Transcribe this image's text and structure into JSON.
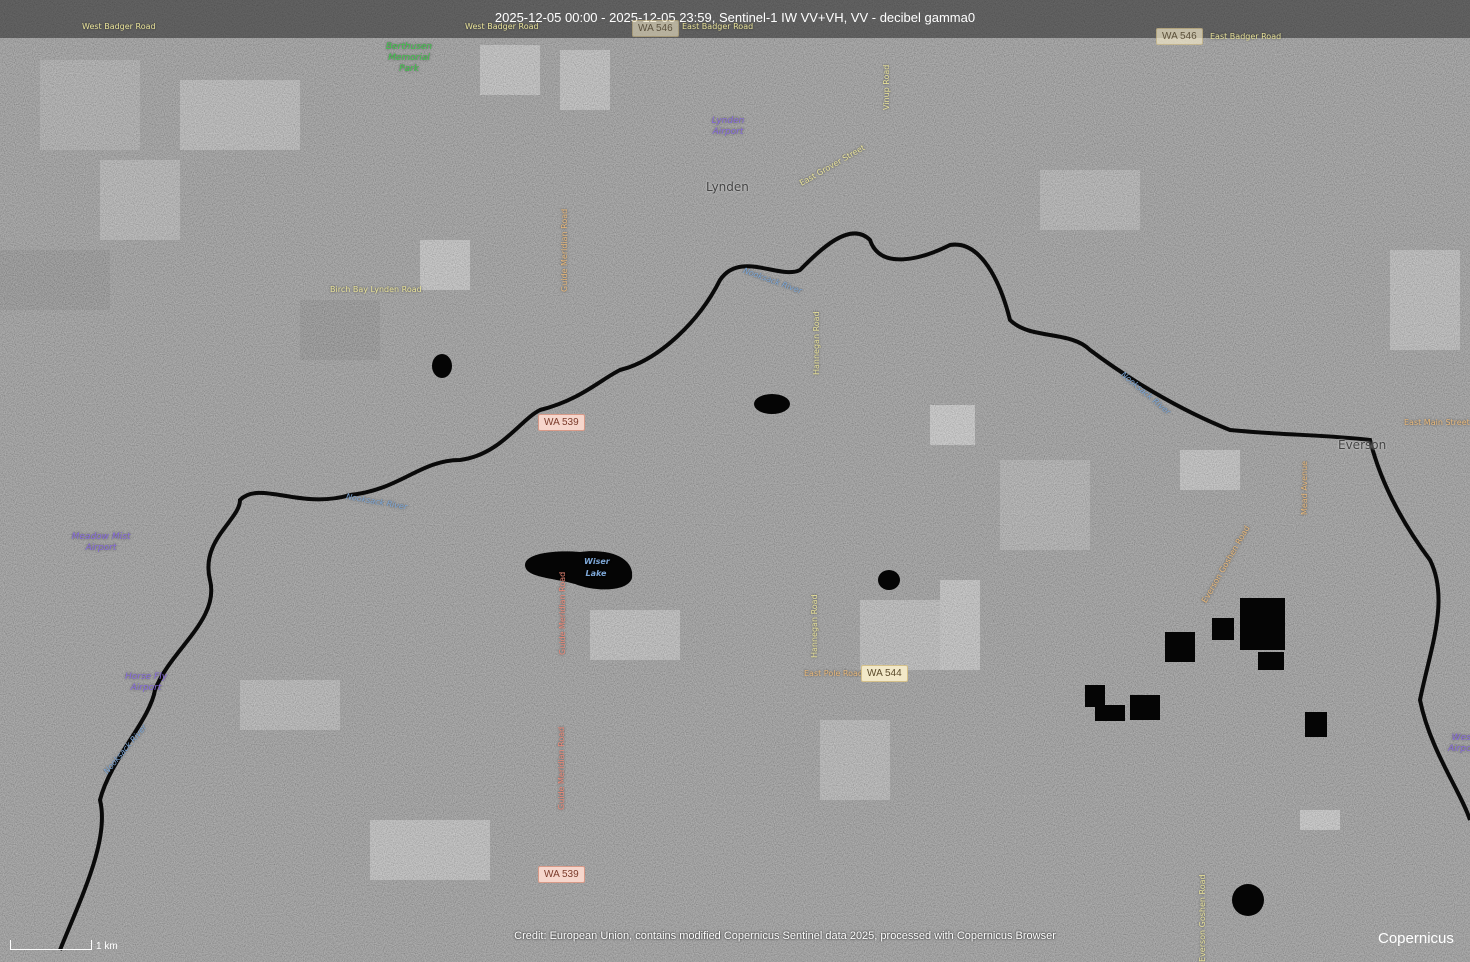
{
  "header": {
    "title": "2025-12-05 00:00 - 2025-12-05 23:59, Sentinel-1 IW VV+VH, VV - decibel gamma0"
  },
  "labels": {
    "west_badger_1": "West Badger Road",
    "west_badger_2": "West Badger Road",
    "east_badger": "East Badger Road",
    "berthusen_park": "Berthusen Memorial Park",
    "vinup_road": "Vinup Road",
    "lynden_airport": "Lynden Airport",
    "lynden": "Lynden",
    "east_grover": "East Grover Street",
    "birch_bay_lynden": "Birch Bay Lynden Road",
    "guide_meridian_1": "Guide Meridian Road",
    "guide_meridian_2": "Guide Meridian Road",
    "guide_meridian_3": "Guide Meridian Road",
    "hannegan_1": "Hannegan Road",
    "hannegan_2": "Hannegan Road",
    "nooksack_1": "Nooksack River",
    "nooksack_2": "Nooksack River",
    "nooksack_3": "Nooksack River",
    "nooksack_4": "Nooksack River",
    "meadow_mist": "Meadow Mist Airport",
    "horse_fly": "Horse Fly Airport",
    "wiser_lake": "Wiser Lake",
    "east_pole": "East Pole Road",
    "everson": "Everson",
    "east_main": "East Main Street",
    "mead_avenue": "Mead Avenue",
    "everson_goshen_1": "Everson Goshen Road",
    "everson_goshen_2": "Everson Goshen Road",
    "west_airport": "West Airport"
  },
  "shields": {
    "wa546_1": "WA 546",
    "wa546_2": "WA 546",
    "wa539_1": "WA 539",
    "wa539_2": "WA 539",
    "wa544": "WA 544"
  },
  "footer": {
    "credit": "Credit: European Union, contains modified Copernicus Sentinel data 2025, processed with Copernicus Browser",
    "scale": "1 km",
    "logo": "Copernicus"
  }
}
